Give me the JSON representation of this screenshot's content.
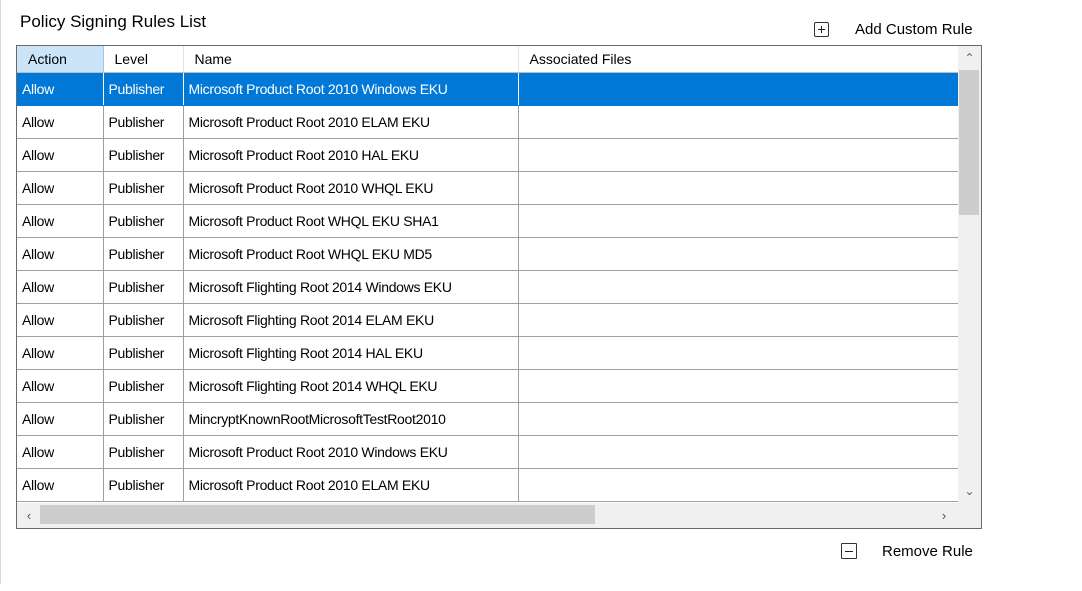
{
  "title": "Policy Signing Rules List",
  "buttons": {
    "add_custom_rule": "Add Custom Rule",
    "remove_rule": "Remove Rule"
  },
  "table": {
    "columns": [
      "Action",
      "Level",
      "Name",
      "Associated Files"
    ],
    "sorted_column": "Action",
    "selected_row": 0,
    "rows": [
      [
        "Allow",
        "Publisher",
        "Microsoft Product Root 2010 Windows EKU",
        ""
      ],
      [
        "Allow",
        "Publisher",
        "Microsoft Product Root 2010 ELAM EKU",
        ""
      ],
      [
        "Allow",
        "Publisher",
        "Microsoft Product Root 2010 HAL EKU",
        ""
      ],
      [
        "Allow",
        "Publisher",
        "Microsoft Product Root 2010 WHQL EKU",
        ""
      ],
      [
        "Allow",
        "Publisher",
        "Microsoft Product Root WHQL EKU SHA1",
        ""
      ],
      [
        "Allow",
        "Publisher",
        "Microsoft Product Root WHQL EKU MD5",
        ""
      ],
      [
        "Allow",
        "Publisher",
        "Microsoft Flighting Root 2014 Windows EKU",
        ""
      ],
      [
        "Allow",
        "Publisher",
        "Microsoft Flighting Root 2014 ELAM EKU",
        ""
      ],
      [
        "Allow",
        "Publisher",
        "Microsoft Flighting Root 2014 HAL EKU",
        ""
      ],
      [
        "Allow",
        "Publisher",
        "Microsoft Flighting Root 2014 WHQL EKU",
        ""
      ],
      [
        "Allow",
        "Publisher",
        "MincryptKnownRootMicrosoftTestRoot2010",
        ""
      ],
      [
        "Allow",
        "Publisher",
        "Microsoft Product Root 2010 Windows EKU",
        ""
      ],
      [
        "Allow",
        "Publisher",
        "Microsoft Product Root 2010 ELAM EKU",
        ""
      ]
    ]
  },
  "icons": {
    "add": "plus-box-icon",
    "remove": "minus-box-icon",
    "scroll_up": "chevron-up-icon",
    "scroll_down": "chevron-down-icon",
    "scroll_left": "chevron-left-icon",
    "scroll_right": "chevron-right-icon"
  },
  "colors": {
    "selection": "#0078d7",
    "sorted_header": "#cce4f7",
    "scrollbar_track": "#f0f0f0",
    "scrollbar_thumb": "#cdcdcd"
  }
}
